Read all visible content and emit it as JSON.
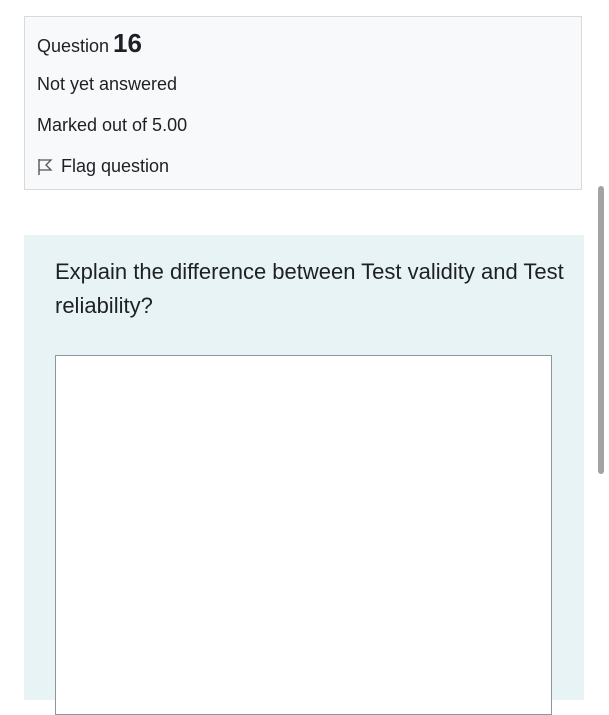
{
  "question": {
    "label": "Question",
    "number": "16",
    "state": "Not yet answered",
    "grade": "Marked out of 5.00",
    "flag_label": "Flag question",
    "text": "Explain the difference between Test validity and Test reliability?"
  },
  "answer": {
    "value": ""
  },
  "colors": {
    "info_bg": "#f8f9fa",
    "content_bg": "#e7f3f5",
    "text": "#1d2125"
  }
}
